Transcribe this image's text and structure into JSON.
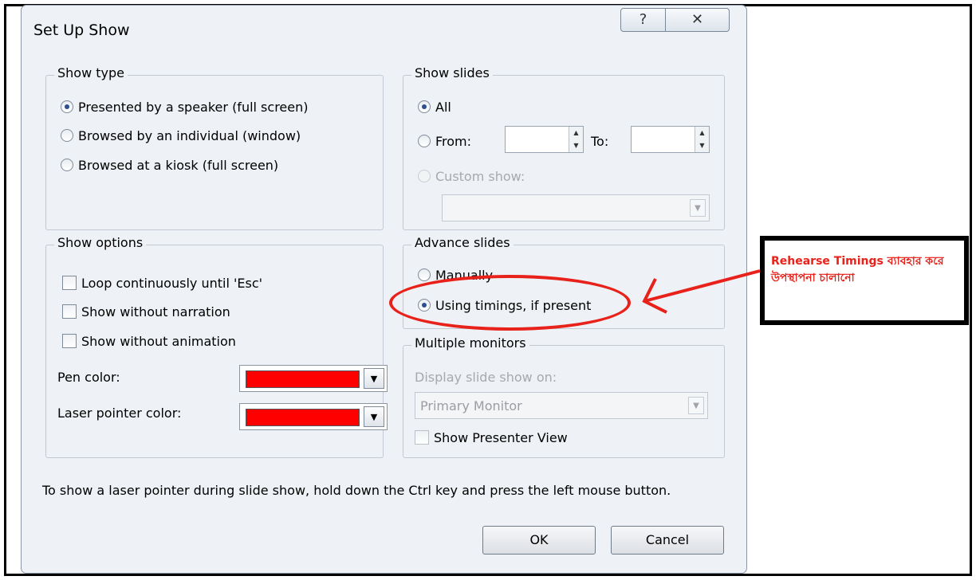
{
  "dialog": {
    "title": "Set Up Show",
    "help_glyph": "?",
    "close_glyph": "✕"
  },
  "show_type": {
    "label": "Show type",
    "options": [
      {
        "label": "Presented by a speaker (full screen)",
        "checked": true
      },
      {
        "label": "Browsed by an individual (window)",
        "checked": false
      },
      {
        "label": "Browsed at a kiosk (full screen)",
        "checked": false
      }
    ]
  },
  "show_slides": {
    "label": "Show slides",
    "all_label": "All",
    "from_label": "From:",
    "to_label": "To:",
    "custom_label": "Custom show:",
    "from_value": "",
    "to_value": "",
    "custom_value": ""
  },
  "show_options": {
    "label": "Show options",
    "checkboxes": [
      {
        "label": "Loop continuously until 'Esc'",
        "checked": false
      },
      {
        "label": "Show without narration",
        "checked": false
      },
      {
        "label": "Show without animation",
        "checked": false
      }
    ],
    "pen_color_label": "Pen color:",
    "pen_color": "#ff0000",
    "laser_color_label": "Laser pointer color:",
    "laser_color": "#ff0000"
  },
  "advance_slides": {
    "label": "Advance slides",
    "manually_label": "Manually",
    "timings_label": "Using timings, if present",
    "selected": "timings"
  },
  "multiple_monitors": {
    "label": "Multiple monitors",
    "display_on_label": "Display slide show on:",
    "display_on_value": "Primary Monitor",
    "presenter_view_label": "Show Presenter View"
  },
  "note": "To show a laser pointer during slide show, hold down the Ctrl key and press the left mouse button.",
  "buttons": {
    "ok": "OK",
    "cancel": "Cancel"
  },
  "annotation": {
    "text": "Rehearse Timings ব্যাবহার করে উপস্থাপনা চালানো",
    "color": "#e8211a"
  }
}
